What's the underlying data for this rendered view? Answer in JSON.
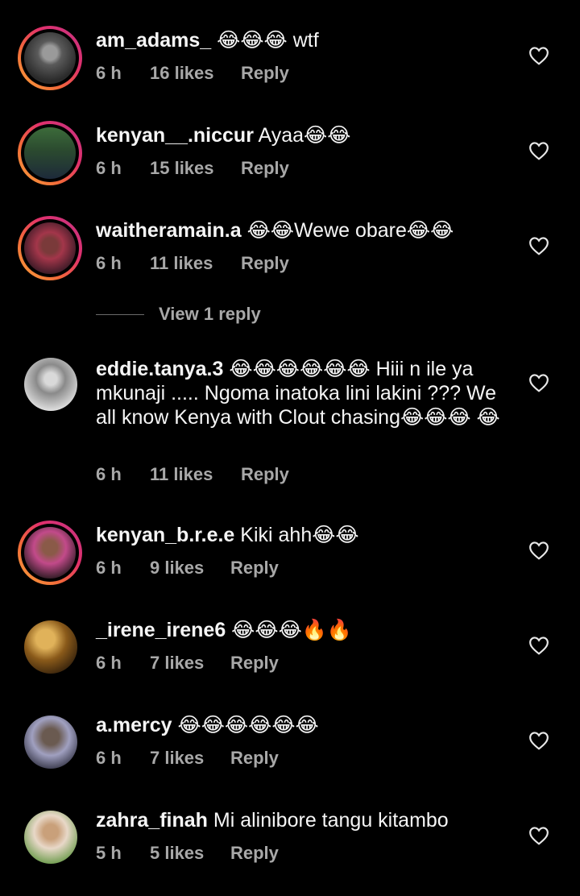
{
  "comments": [
    {
      "username": "am_adams_",
      "text": "😂😂😂 wtf",
      "time": "6 h",
      "likes": "16 likes",
      "reply": "Reply",
      "avatar": "ring"
    },
    {
      "username": "kenyan__.niccur",
      "text": "Ayaa😂😂",
      "time": "6 h",
      "likes": "15 likes",
      "reply": "Reply",
      "avatar": "ring"
    },
    {
      "username": "waitheramain.a",
      "text": "😂😂Wewe obare😂😂",
      "time": "6 h",
      "likes": "11 likes",
      "reply": "Reply",
      "avatar": "ring"
    },
    {
      "username": "eddie.tanya.3",
      "text": "😂😂😂😂😂😂 Hiii n ile ya mkunaji ..... Ngoma inatoka lini lakini ??? We all know Kenya with Clout chasing😂😂😂 😂",
      "time": "6 h",
      "likes": "11 likes",
      "reply": "Reply",
      "avatar": "plain"
    },
    {
      "username": "kenyan_b.r.e.e",
      "text": "Kiki ahh😂😂",
      "time": "6 h",
      "likes": "9 likes",
      "reply": "Reply",
      "avatar": "ring"
    },
    {
      "username": "_irene_irene6",
      "text": "😂😂😂🔥🔥",
      "time": "6 h",
      "likes": "7 likes",
      "reply": "Reply",
      "avatar": "plain"
    },
    {
      "username": "a.mercy",
      "text": "😂😂😂😂😂😂",
      "time": "6 h",
      "likes": "7 likes",
      "reply": "Reply",
      "avatar": "plain"
    },
    {
      "username": "zahra_finah",
      "text": "Mi alinibore tangu kitambo",
      "time": "5 h",
      "likes": "5 likes",
      "reply": "Reply",
      "avatar": "plain"
    }
  ],
  "view_replies_label": "View 1 reply",
  "colors": {
    "background": "#000000",
    "text": "#f5f5f5",
    "muted": "#a8a8a8",
    "ring_start": "#f9a53a",
    "ring_end": "#c13584"
  },
  "icons": {
    "like": "heart-outline-icon",
    "emoji_laugh": "face-with-tears-of-joy",
    "emoji_fire": "fire"
  }
}
